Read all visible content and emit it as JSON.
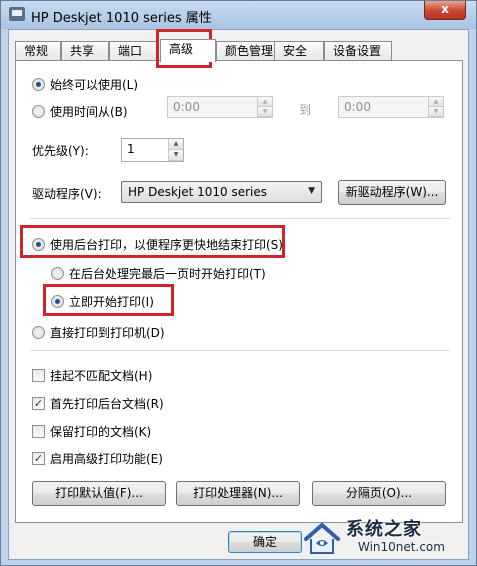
{
  "window": {
    "title": "HP Deskjet 1010 series 属性",
    "close_glyph": "x"
  },
  "tabs": [
    {
      "label": "常规",
      "active": false
    },
    {
      "label": "共享",
      "active": false
    },
    {
      "label": "端口",
      "active": false
    },
    {
      "label": "高级",
      "active": true
    },
    {
      "label": "颜色管理",
      "active": false
    },
    {
      "label": "安全",
      "active": false
    },
    {
      "label": "设备设置",
      "active": false
    }
  ],
  "availability": {
    "always": {
      "label": "始终可以使用(L)",
      "checked": true
    },
    "from": {
      "label": "使用时间从(B)",
      "checked": false
    },
    "from_time": "0:00",
    "to_label": "到",
    "to_time": "0:00"
  },
  "priority": {
    "label": "优先级(Y):",
    "value": "1"
  },
  "driver": {
    "label": "驱动程序(V):",
    "selected": "HP Deskjet 1010 series",
    "new_driver_button": "新驱动程序(W)..."
  },
  "spool": {
    "spool_option": {
      "label": "使用后台打印，以便程序更快地结束打印(S)",
      "checked": true
    },
    "after_last_page": {
      "label": "在后台处理完最后一页时开始打印(T)",
      "checked": false
    },
    "immediately": {
      "label": "立即开始打印(I)",
      "checked": true
    },
    "direct": {
      "label": "直接打印到打印机(D)",
      "checked": false
    }
  },
  "options": [
    {
      "label": "挂起不匹配文档(H)",
      "checked": false
    },
    {
      "label": "首先打印后台文档(R)",
      "checked": true
    },
    {
      "label": "保留打印的文档(K)",
      "checked": false
    },
    {
      "label": "启用高级打印功能(E)",
      "checked": true
    }
  ],
  "buttons": {
    "print_defaults": "打印默认值(F)...",
    "print_processor": "打印处理器(N)...",
    "separator_page": "分隔页(O)...",
    "ok": "确定"
  },
  "icons": {
    "spin_up": "▲",
    "spin_down": "▼",
    "dropdown": "▼",
    "checkmark": "✓"
  },
  "watermark": {
    "title": "系统之家",
    "url": "Win10net.com"
  },
  "colors": {
    "highlight": "#d1232b",
    "selected_radio": "#1a4f9a"
  }
}
